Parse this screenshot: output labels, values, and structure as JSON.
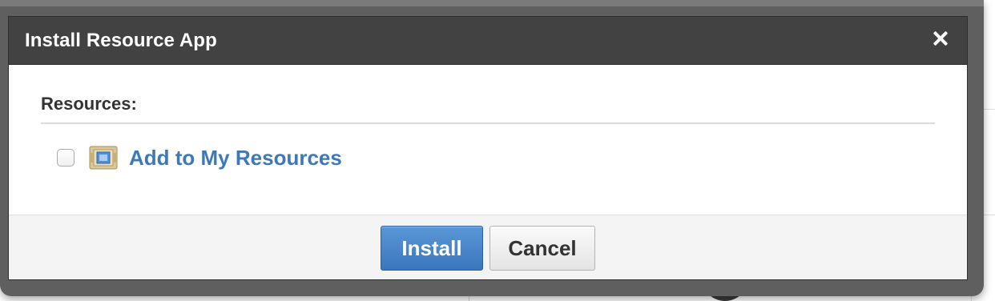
{
  "dialog": {
    "title": "Install Resource App",
    "close_icon": "close-icon"
  },
  "resources": {
    "section_label": "Resources:",
    "options": [
      {
        "label": "Add to My Resources",
        "checked": false,
        "icon": "resource-app-icon"
      }
    ]
  },
  "footer": {
    "install_label": "Install",
    "cancel_label": "Cancel"
  },
  "colors": {
    "header_bg": "#424242",
    "link_blue": "#3d78b8",
    "primary_button": "#3b76bd"
  }
}
